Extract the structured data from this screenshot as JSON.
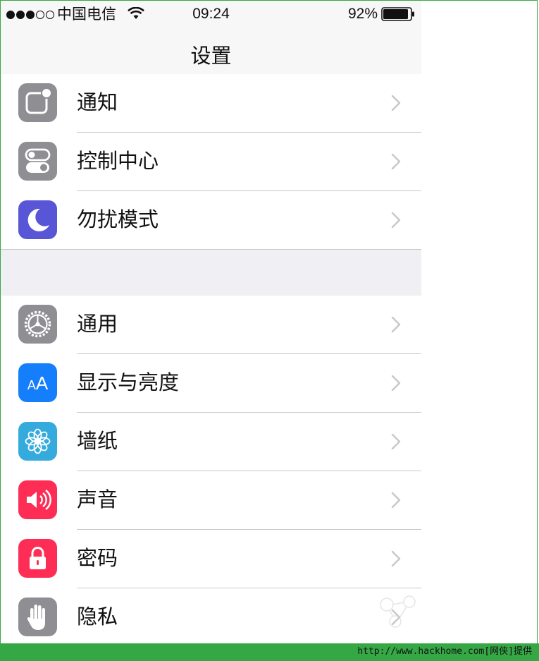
{
  "status_bar": {
    "signal_bars_filled": 3,
    "signal_bars_total": 5,
    "carrier": "中国电信",
    "time": "09:24",
    "battery_percent": "92%",
    "battery_level": 0.92
  },
  "nav": {
    "title": "设置"
  },
  "groups": [
    {
      "items": [
        {
          "label": "通知",
          "icon": "notifications-icon",
          "color": "#8e8e93"
        },
        {
          "label": "控制中心",
          "icon": "control-center-icon",
          "color": "#8e8e93"
        },
        {
          "label": "勿扰模式",
          "icon": "do-not-disturb-moon-icon",
          "color": "#5856d6"
        }
      ]
    },
    {
      "items": [
        {
          "label": "通用",
          "icon": "general-gear-icon",
          "color": "#8e8e93"
        },
        {
          "label": "显示与亮度",
          "icon": "display-brightness-aa-icon",
          "color": "#147efb",
          "icon_text": "AA"
        },
        {
          "label": "墙纸",
          "icon": "wallpaper-flower-icon",
          "color": "#35aadc"
        },
        {
          "label": "声音",
          "icon": "sounds-speaker-icon",
          "color": "#fe2d55"
        },
        {
          "label": "密码",
          "icon": "passcode-lock-icon",
          "color": "#fe2d55"
        },
        {
          "label": "隐私",
          "icon": "privacy-hand-icon",
          "color": "#8e8e93"
        }
      ]
    }
  ],
  "watermark": {
    "text": "http://www.hackhome.com[网侠]提供"
  }
}
